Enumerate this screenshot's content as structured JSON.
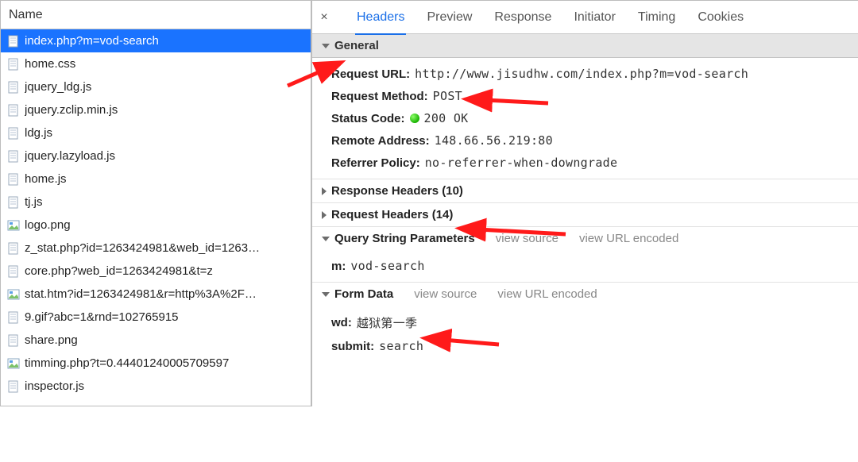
{
  "left": {
    "header": "Name",
    "files": [
      {
        "label": "index.php?m=vod-search",
        "type": "doc",
        "selected": true
      },
      {
        "label": "home.css",
        "type": "doc"
      },
      {
        "label": "jquery_ldg.js",
        "type": "doc"
      },
      {
        "label": "jquery.zclip.min.js",
        "type": "doc"
      },
      {
        "label": "ldg.js",
        "type": "doc"
      },
      {
        "label": "jquery.lazyload.js",
        "type": "doc"
      },
      {
        "label": "home.js",
        "type": "doc"
      },
      {
        "label": "tj.js",
        "type": "doc"
      },
      {
        "label": "logo.png",
        "type": "img"
      },
      {
        "label": "z_stat.php?id=1263424981&web_id=1263…",
        "type": "doc"
      },
      {
        "label": "core.php?web_id=1263424981&t=z",
        "type": "doc"
      },
      {
        "label": "stat.htm?id=1263424981&r=http%3A%2F…",
        "type": "img"
      },
      {
        "label": "9.gif?abc=1&rnd=102765915",
        "type": "doc"
      },
      {
        "label": "share.png",
        "type": "doc"
      },
      {
        "label": "timming.php?t=0.44401240005709597",
        "type": "img"
      },
      {
        "label": "inspector.js",
        "type": "doc"
      }
    ]
  },
  "tabs": {
    "close": "×",
    "items": [
      "Headers",
      "Preview",
      "Response",
      "Initiator",
      "Timing",
      "Cookies"
    ],
    "active": 0
  },
  "general": {
    "title": "General",
    "request_url": {
      "key": "Request URL:",
      "value": "http://www.jisudhw.com/index.php?m=vod-search"
    },
    "request_method": {
      "key": "Request Method:",
      "value": "POST"
    },
    "status_code": {
      "key": "Status Code:",
      "value": "200 OK"
    },
    "remote_address": {
      "key": "Remote Address:",
      "value": "148.66.56.219:80"
    },
    "referrer_policy": {
      "key": "Referrer Policy:",
      "value": "no-referrer-when-downgrade"
    }
  },
  "response_headers": {
    "title": "Response Headers (10)"
  },
  "request_headers": {
    "title": "Request Headers (14)"
  },
  "qsp": {
    "title": "Query String Parameters",
    "view_source": "view source",
    "view_encoded": "view URL encoded",
    "m": {
      "key": "m:",
      "value": "vod-search"
    }
  },
  "form": {
    "title": "Form Data",
    "view_source": "view source",
    "view_encoded": "view URL encoded",
    "wd": {
      "key": "wd:",
      "value": "越狱第一季"
    },
    "submit": {
      "key": "submit:",
      "value": "search"
    }
  }
}
